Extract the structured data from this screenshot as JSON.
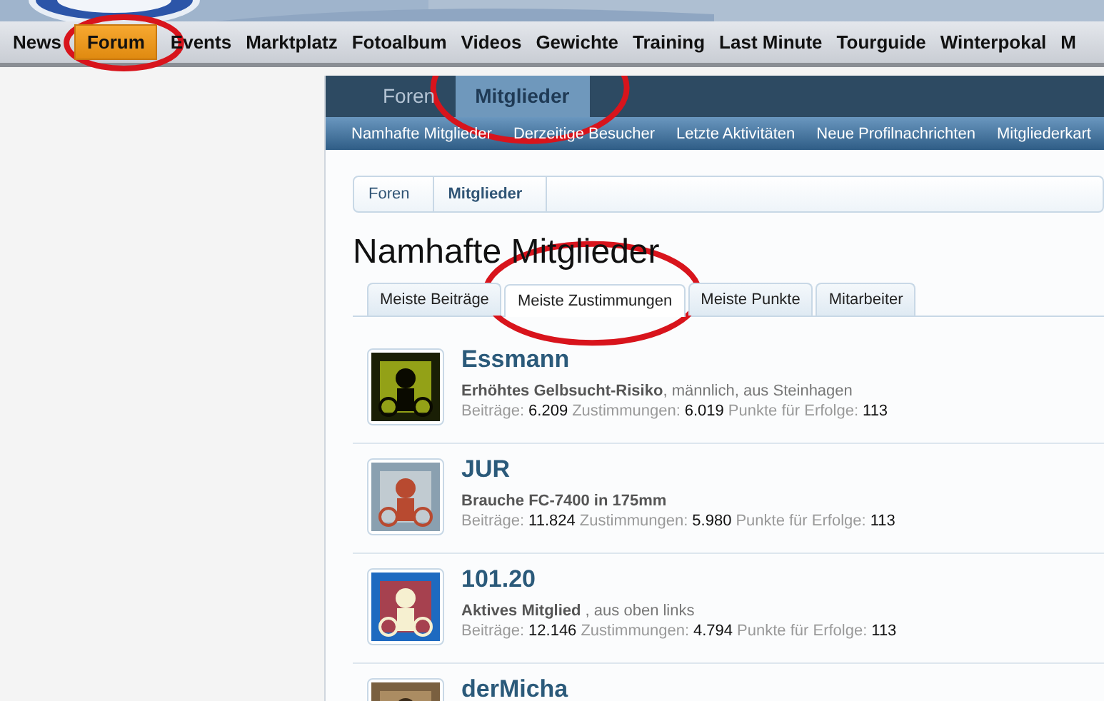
{
  "main_nav": [
    {
      "label": "News",
      "selected": false,
      "circled": false
    },
    {
      "label": "Forum",
      "selected": true,
      "circled": true
    },
    {
      "label": "Events",
      "selected": false,
      "circled": false
    },
    {
      "label": "Marktplatz",
      "selected": false,
      "circled": false
    },
    {
      "label": "Fotoalbum",
      "selected": false,
      "circled": false
    },
    {
      "label": "Videos",
      "selected": false,
      "circled": false
    },
    {
      "label": "Gewichte",
      "selected": false,
      "circled": false
    },
    {
      "label": "Training",
      "selected": false,
      "circled": false
    },
    {
      "label": "Last Minute",
      "selected": false,
      "circled": false
    },
    {
      "label": "Tourguide",
      "selected": false,
      "circled": false
    },
    {
      "label": "Winterpokal",
      "selected": false,
      "circled": false
    },
    {
      "label": "M",
      "selected": false,
      "circled": false
    }
  ],
  "forum_tabs": [
    {
      "label": "Foren",
      "selected": false,
      "circled": false
    },
    {
      "label": "Mitglieder",
      "selected": true,
      "circled": true
    }
  ],
  "sub_nav": [
    "Namhafte Mitglieder",
    "Derzeitige Besucher",
    "Letzte Aktivitäten",
    "Neue Profilnachrichten",
    "Mitgliederkart"
  ],
  "breadcrumb": [
    {
      "label": "Foren",
      "current": false
    },
    {
      "label": "Mitglieder",
      "current": true
    }
  ],
  "heading": "Namhafte Mitglieder",
  "list_tabs": [
    {
      "label": "Meiste Beiträge",
      "selected": false,
      "circled": false
    },
    {
      "label": "Meiste Zustimmungen",
      "selected": true,
      "circled": true
    },
    {
      "label": "Meiste Punkte",
      "selected": false,
      "circled": false
    },
    {
      "label": "Mitarbeiter",
      "selected": false,
      "circled": false
    }
  ],
  "members": [
    {
      "name": "Essmann",
      "info": "**Erhöhtes Gelbsucht-Risiko**, männlich, aus Steinhagen",
      "stats": [
        {
          "label": "Beiträge:",
          "value": "6.209"
        },
        {
          "label": "Zustimmungen:",
          "value": "6.019"
        },
        {
          "label": "Punkte für Erfolge:",
          "value": "113"
        }
      ]
    },
    {
      "name": "JUR",
      "info": "**Brauche FC-7400 in 175mm**",
      "stats": [
        {
          "label": "Beiträge:",
          "value": "11.824"
        },
        {
          "label": "Zustimmungen:",
          "value": "5.980"
        },
        {
          "label": "Punkte für Erfolge:",
          "value": "113"
        }
      ]
    },
    {
      "name": "101.20",
      "info": "**Aktives Mitglied** , aus oben links",
      "stats": [
        {
          "label": "Beiträge:",
          "value": "12.146"
        },
        {
          "label": "Zustimmungen:",
          "value": "4.794"
        },
        {
          "label": "Punkte für Erfolge:",
          "value": "113"
        }
      ]
    },
    {
      "name": "derMicha"
    }
  ]
}
